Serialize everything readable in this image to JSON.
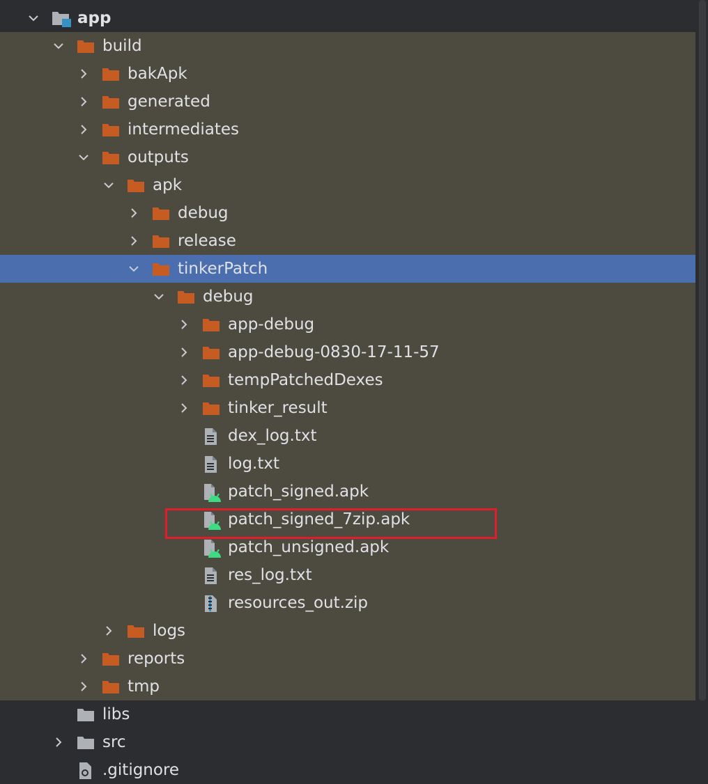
{
  "colors": {
    "background": "#2b2d30",
    "build_background": "#4d4a40",
    "selection": "#4b6eaf",
    "folder": "#c75c22",
    "file": "#aeb2b7",
    "android": "#3ddc84",
    "highlight": "#e01e2b"
  },
  "tree": [
    {
      "label": "app",
      "icon": "module-folder-icon",
      "depth": 0,
      "expanded": true,
      "bold": true,
      "zone": "dark"
    },
    {
      "label": "build",
      "icon": "folder-icon",
      "depth": 1,
      "expanded": true,
      "zone": "build"
    },
    {
      "label": "bakApk",
      "icon": "folder-icon",
      "depth": 2,
      "expanded": false,
      "zone": "build"
    },
    {
      "label": "generated",
      "icon": "folder-icon",
      "depth": 2,
      "expanded": false,
      "zone": "build"
    },
    {
      "label": "intermediates",
      "icon": "folder-icon",
      "depth": 2,
      "expanded": false,
      "zone": "build"
    },
    {
      "label": "outputs",
      "icon": "folder-icon",
      "depth": 2,
      "expanded": true,
      "zone": "build"
    },
    {
      "label": "apk",
      "icon": "folder-icon",
      "depth": 3,
      "expanded": true,
      "zone": "build"
    },
    {
      "label": "debug",
      "icon": "folder-icon",
      "depth": 4,
      "expanded": false,
      "zone": "build"
    },
    {
      "label": "release",
      "icon": "folder-icon",
      "depth": 4,
      "expanded": false,
      "zone": "build"
    },
    {
      "label": "tinkerPatch",
      "icon": "folder-icon",
      "depth": 4,
      "expanded": true,
      "zone": "build",
      "selected": true
    },
    {
      "label": "debug",
      "icon": "folder-icon",
      "depth": 5,
      "expanded": true,
      "zone": "build"
    },
    {
      "label": "app-debug",
      "icon": "folder-icon",
      "depth": 6,
      "expanded": false,
      "zone": "build"
    },
    {
      "label": "app-debug-0830-17-11-57",
      "icon": "folder-icon",
      "depth": 6,
      "expanded": false,
      "zone": "build"
    },
    {
      "label": "tempPatchedDexes",
      "icon": "folder-icon",
      "depth": 6,
      "expanded": false,
      "zone": "build"
    },
    {
      "label": "tinker_result",
      "icon": "folder-icon",
      "depth": 6,
      "expanded": false,
      "zone": "build"
    },
    {
      "label": "dex_log.txt",
      "icon": "text-file-icon",
      "depth": 6,
      "zone": "build"
    },
    {
      "label": "log.txt",
      "icon": "text-file-icon",
      "depth": 6,
      "zone": "build"
    },
    {
      "label": "patch_signed.apk",
      "icon": "apk-file-icon",
      "depth": 6,
      "zone": "build"
    },
    {
      "label": "patch_signed_7zip.apk",
      "icon": "apk-file-icon",
      "depth": 6,
      "zone": "build",
      "highlighted": true
    },
    {
      "label": "patch_unsigned.apk",
      "icon": "apk-file-icon",
      "depth": 6,
      "zone": "build"
    },
    {
      "label": "res_log.txt",
      "icon": "text-file-icon",
      "depth": 6,
      "zone": "build"
    },
    {
      "label": "resources_out.zip",
      "icon": "zip-file-icon",
      "depth": 6,
      "zone": "build"
    },
    {
      "label": "logs",
      "icon": "folder-icon",
      "depth": 3,
      "expanded": false,
      "zone": "build"
    },
    {
      "label": "reports",
      "icon": "folder-icon",
      "depth": 2,
      "expanded": false,
      "zone": "build"
    },
    {
      "label": "tmp",
      "icon": "folder-icon",
      "depth": 2,
      "expanded": false,
      "zone": "build"
    },
    {
      "label": "libs",
      "icon": "gray-folder-icon",
      "depth": 1,
      "zone": "dark"
    },
    {
      "label": "src",
      "icon": "gray-folder-icon",
      "depth": 1,
      "expanded": false,
      "zone": "dark"
    },
    {
      "label": ".gitignore",
      "icon": "gitignore-file-icon",
      "depth": 1,
      "zone": "dark"
    }
  ]
}
